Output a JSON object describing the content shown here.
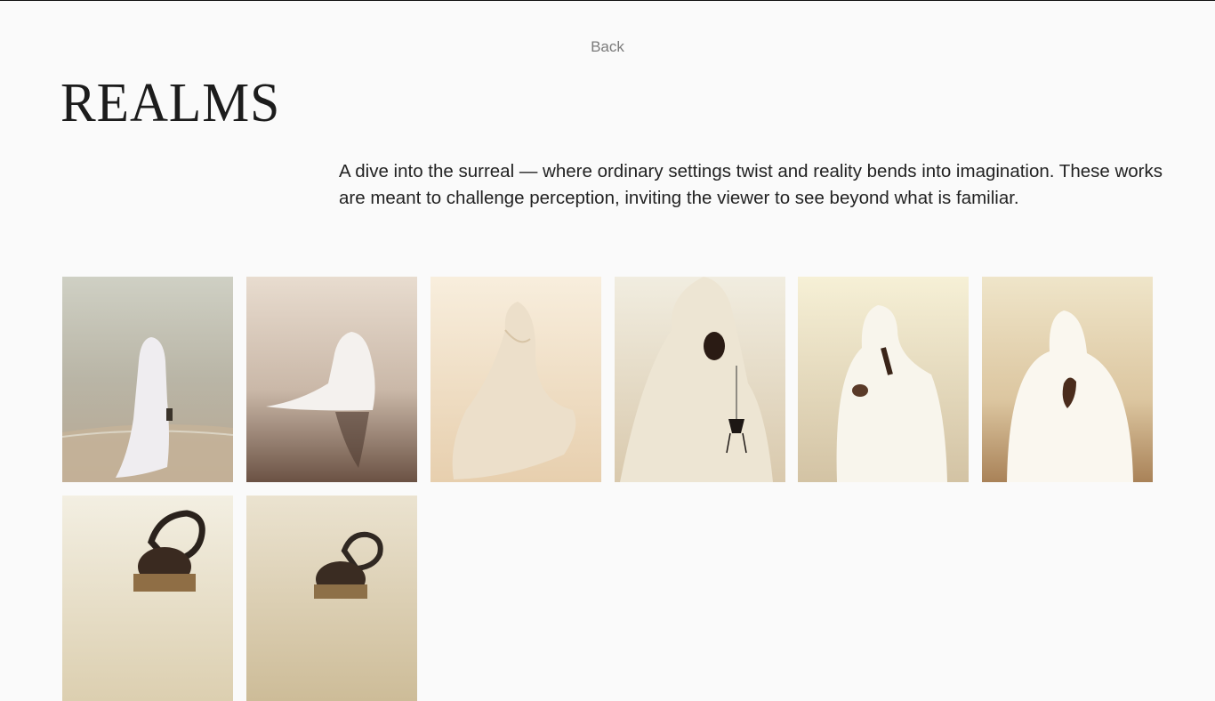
{
  "nav": {
    "back_label": "Back"
  },
  "page": {
    "title": "REALMS",
    "description": "A dive into the surreal — where ordinary settings twist and reality bends into imagination. These works are meant to challenge perception, inviting the viewer to see beyond what is familiar."
  },
  "colors": {
    "background": "#fafafa",
    "text": "#222222",
    "muted": "#7a7a7a"
  },
  "gallery": {
    "items": [
      {
        "subject": "veiled figure on beach shore",
        "tones": [
          "#c9c8b8",
          "#b8ab96"
        ]
      },
      {
        "subject": "veiled figure seated in water",
        "tones": [
          "#e6d6c8",
          "#6e5648"
        ]
      },
      {
        "subject": "figure in flowing cloth",
        "tones": [
          "#f5ead8",
          "#e6cfae"
        ]
      },
      {
        "subject": "veiled figure holding lantern",
        "tones": [
          "#efe8d6",
          "#d8c8aa"
        ]
      },
      {
        "subject": "veiled figure with clasped hands",
        "tones": [
          "#f3ecd0",
          "#cfc0a0"
        ]
      },
      {
        "subject": "veiled figure with clasped hands",
        "tones": [
          "#eee2c4",
          "#b58d60"
        ]
      },
      {
        "subject": "figure with sculptural headpiece",
        "tones": [
          "#f1ecdc",
          "#d9cbaa"
        ]
      },
      {
        "subject": "figure with sculptural headpiece",
        "tones": [
          "#e9dfca",
          "#cdbc98"
        ]
      }
    ]
  }
}
